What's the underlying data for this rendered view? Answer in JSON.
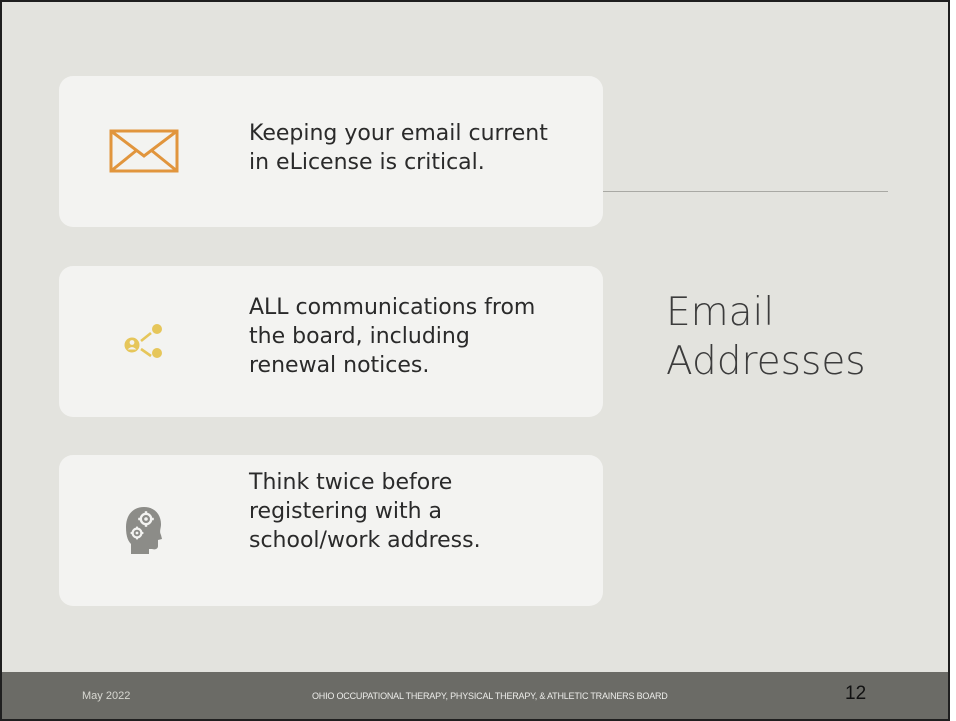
{
  "slide": {
    "title": "Email\nAddresses",
    "cards": [
      {
        "icon": "envelope-icon",
        "text": "Keeping your email current\nin eLicense is critical.",
        "icon_color": "#e1953d"
      },
      {
        "icon": "share-contact-icon",
        "text": "ALL communications from\nthe board, including\nrenewal notices.",
        "icon_color": "#e6c65a"
      },
      {
        "icon": "head-gears-icon",
        "text": "Think twice before\nregistering with a\nschool/work address.",
        "icon_color": "#8c8c88"
      }
    ]
  },
  "footer": {
    "date": "May 2022",
    "board": "OHIO OCCUPATIONAL THERAPY, PHYSICAL THERAPY, & ATHLETIC TRAINERS BOARD",
    "page_number": "12"
  },
  "colors": {
    "background": "#e3e3de",
    "card": "#f3f3f1",
    "footer": "#6b6b66"
  }
}
